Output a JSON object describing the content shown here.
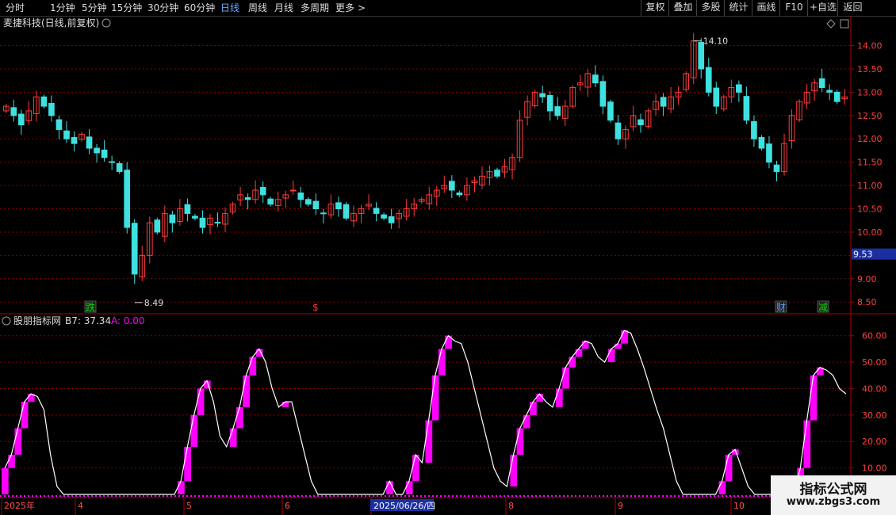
{
  "toolbar": {
    "periods": [
      "分时",
      "1分钟",
      "5分钟",
      "15分钟",
      "30分钟",
      "60分钟",
      "日线",
      "周线",
      "月线",
      "多周期",
      "更多 >"
    ],
    "active": "日线",
    "right_buttons": [
      "复权",
      "叠加",
      "多股",
      "统计",
      "画线",
      "F10",
      "+自选",
      "返回"
    ]
  },
  "price_panel": {
    "title": "麦捷科技(日线,前复权)",
    "high_label": "14.10",
    "low_label": "8.49",
    "current_price": "9.53",
    "y_ticks": [
      "14.00",
      "13.50",
      "13.00",
      "12.50",
      "12.00",
      "11.50",
      "11.00",
      "10.50",
      "10.00",
      "9.50",
      "9.00",
      "8.50"
    ],
    "markers": [
      {
        "text": "跌",
        "color": "#00dd00"
      },
      {
        "text": "$",
        "color": "#ff3333"
      },
      {
        "text": "财",
        "color": "#5599ff"
      },
      {
        "text": "减",
        "color": "#00dd00"
      }
    ]
  },
  "indicator_panel": {
    "name": "股朋指标网",
    "b7_label": "B7: 37.34",
    "a_label": "A: 0.00",
    "y_ticks": [
      "60.00",
      "50.00",
      "40.00",
      "30.00",
      "20.00",
      "10.00"
    ]
  },
  "x_axis": {
    "labels": [
      "2025年",
      "4",
      "5",
      "6",
      "2025/06/26/四",
      "8",
      "9",
      "10"
    ]
  },
  "colors": {
    "up": "#ff3b3b",
    "down": "#3fe0e0",
    "magenta": "#ff00ff",
    "axis": "#b00000",
    "grid": "#8a0000"
  },
  "chart_data": [
    {
      "type": "candlestick",
      "title": "麦捷科技(日线,前复权)",
      "ylim": [
        8.3,
        14.4
      ],
      "y_ticks": [
        8.5,
        9.0,
        9.5,
        10.0,
        10.5,
        11.0,
        11.5,
        12.0,
        12.5,
        13.0,
        13.5,
        14.0
      ],
      "annotations": {
        "high": 14.1,
        "low": 8.49,
        "current": 9.53
      },
      "close_series_approx": [
        12.7,
        12.5,
        12.3,
        12.6,
        12.9,
        12.7,
        12.5,
        12.2,
        12.0,
        11.9,
        12.1,
        11.8,
        11.7,
        11.6,
        11.5,
        11.3,
        10.1,
        9.1,
        9.5,
        10.2,
        10.0,
        10.4,
        10.2,
        10.5,
        10.4,
        10.3,
        10.1,
        10.3,
        10.2,
        10.4,
        10.6,
        10.8,
        10.7,
        10.9,
        10.8,
        10.6,
        10.7,
        10.8,
        10.9,
        10.7,
        10.6,
        10.5,
        10.4,
        10.6,
        10.5,
        10.3,
        10.4,
        10.5,
        10.6,
        10.4,
        10.3,
        10.2,
        10.4,
        10.5,
        10.6,
        10.7,
        10.8,
        10.9,
        11.0,
        10.9,
        10.8,
        11.0,
        11.1,
        11.2,
        11.3,
        11.2,
        11.4,
        11.6,
        12.4,
        12.8,
        13.0,
        12.9,
        12.6,
        12.5,
        12.7,
        13.1,
        13.2,
        13.4,
        13.2,
        12.7,
        12.4,
        12.0,
        12.2,
        12.5,
        12.3,
        12.6,
        12.8,
        12.7,
        12.9,
        13.0,
        13.4,
        14.1,
        13.5,
        13.0,
        12.7,
        12.9,
        13.1,
        13.0,
        12.4,
        12.0,
        11.8,
        11.5,
        11.3,
        11.9,
        12.5,
        12.8,
        13.0,
        13.2,
        13.1,
        13.0,
        12.8,
        12.9
      ]
    },
    {
      "type": "line",
      "title": "股朋指标网",
      "ylim": [
        0,
        65
      ],
      "y_ticks": [
        10,
        20,
        30,
        40,
        50,
        60
      ],
      "series": [
        {
          "name": "B7",
          "last": 37.34,
          "values": [
            10,
            15,
            25,
            35,
            38,
            37,
            32,
            15,
            3,
            0,
            0,
            0,
            0,
            0,
            0,
            0,
            0,
            0,
            0,
            0,
            0,
            0,
            0,
            0,
            0,
            0,
            0,
            5,
            18,
            30,
            40,
            43,
            35,
            22,
            18,
            25,
            33,
            45,
            52,
            55,
            50,
            40,
            33,
            35,
            35,
            25,
            15,
            5,
            0,
            0,
            0,
            0,
            0,
            0,
            0,
            0,
            0,
            0,
            0,
            5,
            0,
            0,
            5,
            15,
            12,
            28,
            45,
            55,
            60,
            58,
            57,
            50,
            40,
            30,
            20,
            10,
            5,
            3,
            15,
            25,
            30,
            35,
            38,
            35,
            33,
            40,
            48,
            52,
            55,
            58,
            57,
            52,
            50,
            55,
            57,
            62,
            61,
            55,
            48,
            40,
            32,
            25,
            15,
            5,
            0,
            0,
            0,
            0,
            0,
            0,
            5,
            15,
            17,
            10,
            3,
            0,
            0,
            0,
            0,
            0,
            0,
            0,
            10,
            28,
            45,
            48,
            47,
            45,
            40,
            38
          ]
        },
        {
          "name": "A",
          "last": 0.0,
          "values": [
            0
          ]
        }
      ]
    }
  ],
  "watermark": {
    "title": "指标公式网",
    "url": "www.zbgs3.com"
  }
}
